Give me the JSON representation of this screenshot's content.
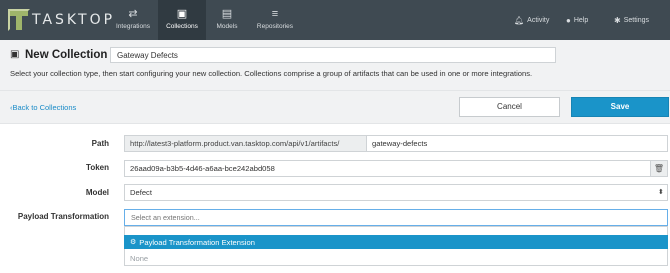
{
  "brand": {
    "name": "TASKTOP"
  },
  "nav": {
    "tabs": [
      {
        "label": "Integrations",
        "icon": "transfer-icon"
      },
      {
        "label": "Collections",
        "icon": "inbox-icon"
      },
      {
        "label": "Models",
        "icon": "document-icon"
      },
      {
        "label": "Repositories",
        "icon": "database-icon"
      }
    ],
    "active_tab": "Collections",
    "right": {
      "activity": "Activity",
      "help": "Help",
      "settings": "Settings"
    }
  },
  "page": {
    "title": "New Collection",
    "name_value": "Gateway Defects",
    "description": "Select your collection type, then start configuring your new collection. Collections comprise a group of artifacts that can be used in one or more integrations."
  },
  "actions": {
    "back": "Back to Collections",
    "cancel": "Cancel",
    "save": "Save"
  },
  "form": {
    "path": {
      "label": "Path",
      "prefix": "http://latest3-platform.product.van.tasktop.com/api/v1/artifacts/",
      "value": "gateway-defects"
    },
    "token": {
      "label": "Token",
      "value": "26aad09a-b3b5-4d46-a6aa-bce242abd058"
    },
    "model": {
      "label": "Model",
      "value": "Defect"
    },
    "payload": {
      "label": "Payload Transformation",
      "placeholder": "Select an extension...",
      "options": [
        "Payload Transformation Extension",
        "None"
      ],
      "highlighted": "Payload Transformation Extension"
    }
  },
  "colors": {
    "topbar": "#3f4a52",
    "accent": "#1a94c9",
    "link": "#1a8bc7",
    "logo_green": "#9fb56b"
  }
}
